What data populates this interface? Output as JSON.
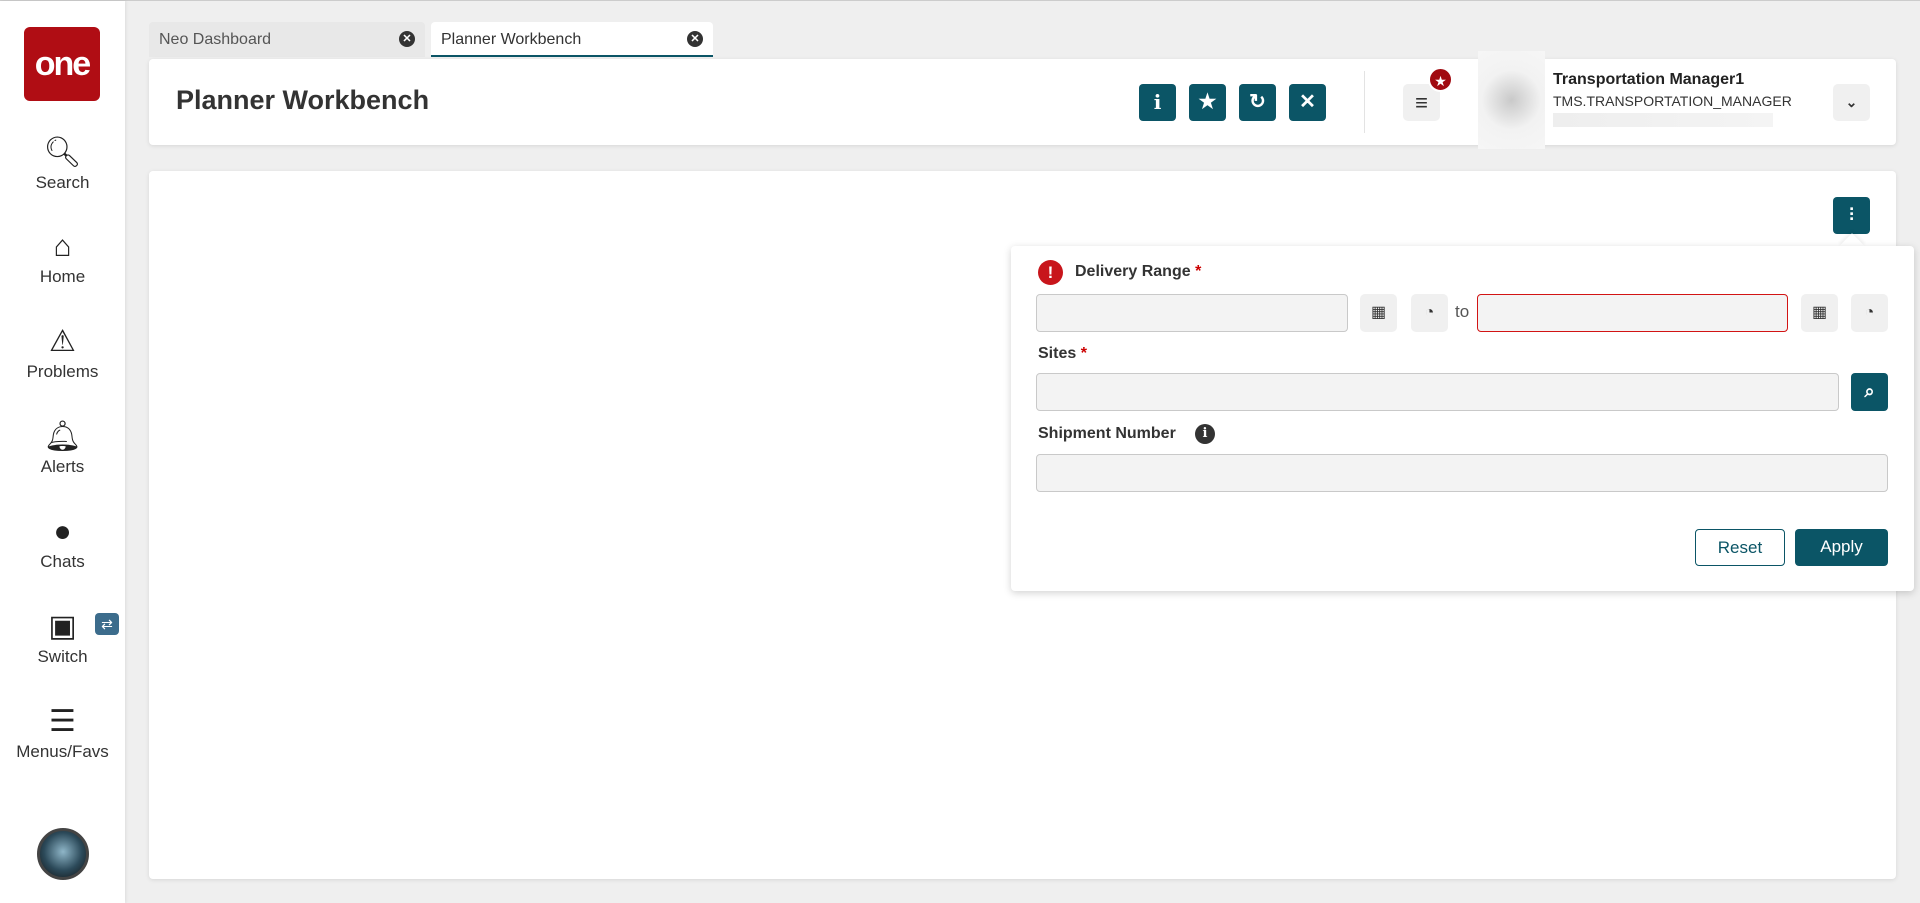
{
  "sidebar": {
    "logo": "one",
    "items": [
      {
        "label": "Search",
        "icon": "search-icon"
      },
      {
        "label": "Home",
        "icon": "home-icon"
      },
      {
        "label": "Problems",
        "icon": "warning-icon"
      },
      {
        "label": "Alerts",
        "icon": "bell-icon"
      },
      {
        "label": "Chats",
        "icon": "chat-icon"
      },
      {
        "label": "Switch",
        "icon": "switch-icon"
      },
      {
        "label": "Menus/Favs",
        "icon": "menu-icon"
      }
    ]
  },
  "tabs": [
    {
      "label": "Neo Dashboard"
    },
    {
      "label": "Planner Workbench",
      "active": true
    }
  ],
  "header": {
    "title": "Planner Workbench",
    "user_name": "Transportation Manager1",
    "user_role": "TMS.TRANSPORTATION_MANAGER"
  },
  "filter": {
    "delivery_range_label": "Delivery Range",
    "required_mark": "*",
    "to_label": "to",
    "sites_label": "Sites",
    "shipment_number_label": "Shipment Number",
    "reset_label": "Reset",
    "apply_label": "Apply",
    "from_value": "",
    "to_value": "",
    "sites_value": "",
    "shipment_number_value": ""
  },
  "colors": {
    "accent": "#0b5566",
    "brand": "#b00d14",
    "error": "#cc0000"
  }
}
